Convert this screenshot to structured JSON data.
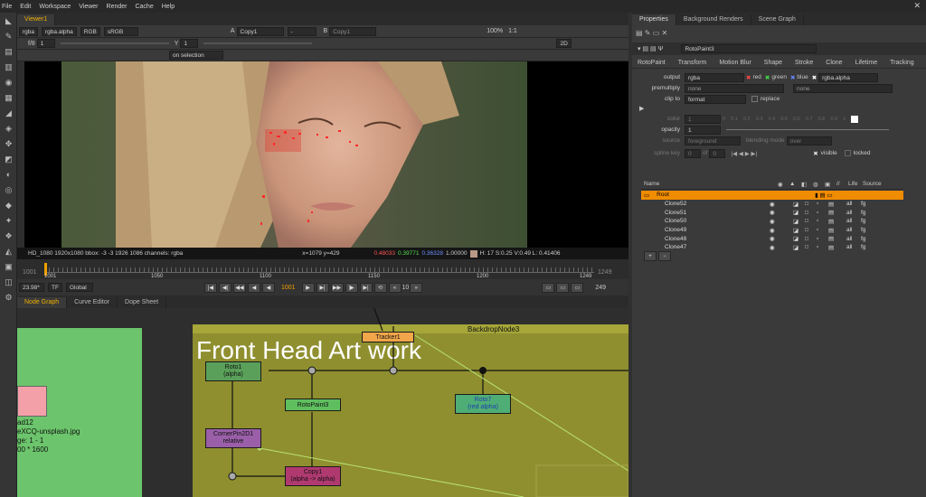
{
  "menu": [
    "File",
    "Edit",
    "Workspace",
    "Viewer",
    "Render",
    "Cache",
    "Help"
  ],
  "viewer_tab": "Viewer1",
  "viewer_controls": {
    "channels": "rgba",
    "layer": "rgba.alpha",
    "colorspace": "RGB",
    "display": "sRGB",
    "input_a_label": "A",
    "input_a": "Copy1",
    "input_a_op": "-",
    "input_b_label": "B",
    "input_b": "Copy1",
    "zoom": "100%",
    "proxy": "1:1",
    "f_stop": "f/8",
    "gain": "1",
    "y_label": "Y",
    "gamma": "1",
    "view_mode": "2D",
    "update_mode": "on selection"
  },
  "info_bar": {
    "format": "HD_1080 1920x1080  bbox: -3 -3 1926 1086 channels: rgba",
    "coords": "x=1079 y=429",
    "r": "0.48033",
    "g": "0.39771",
    "b": "0.36328",
    "a": "1.00000",
    "hsvl": "H: 17 S:0.25 V:0.49  L: 0.41406"
  },
  "timeline": {
    "in": "1001",
    "out": "1249",
    "ticks": [
      "1001",
      "1050",
      "1100",
      "1150",
      "1200",
      "1249"
    ],
    "fps": "23.98*",
    "tf": "TF",
    "range": "Global",
    "current_frame": "1001",
    "increment": "10",
    "end_frame": "249"
  },
  "bottom_tabs": [
    "Node Graph",
    "Curve Editor",
    "Dope Sheet"
  ],
  "node_graph": {
    "backdrop_name": "BackdropNode3",
    "backdrop_label": "Front Head Art work",
    "read_node_lines": [
      "ad12",
      "eXCQ-unsplash.jpg",
      "ge: 1 - 1",
      "00 * 1600"
    ],
    "nodes": {
      "tracker": "Tracker1",
      "roto1": "Roto1",
      "roto1_sub": "(alpha)",
      "rotopaint": "RotoPaint3",
      "roto7": "Roto7",
      "roto7_sub": "(red alpha)",
      "cornerpin": "CornerPin2D1",
      "cornerpin_sub": "relative",
      "copy": "Copy1",
      "copy_sub": "(alpha -> alpha)"
    },
    "colors": {
      "backdrop": "#8f8f30",
      "roto": "#5aa05a",
      "rotopaint": "#5fbf5f",
      "tracker": "#f2a64a",
      "cornerpin": "#9a5fa8",
      "copy": "#b03a70",
      "read_bg": "#6cc56c"
    }
  },
  "properties": {
    "tabs": [
      "Properties",
      "Background Renders",
      "Scene Graph"
    ],
    "node_name": "RotoPaint3",
    "sub_tabs": [
      "RotoPaint",
      "Transform",
      "Motion Blur",
      "Shape",
      "Stroke",
      "Clone",
      "Lifetime",
      "Tracking"
    ],
    "output_label": "output",
    "output": "rgba",
    "red": "red",
    "green": "green",
    "blue": "blue",
    "alpha": "rgba.alpha",
    "premultiply_label": "premultiply",
    "premultiply": "none",
    "premultiply_2": "none",
    "clip_to_label": "clip to",
    "clip_to": "format",
    "replace": "replace",
    "color_label": "color",
    "color_value": "1",
    "color_ticks": [
      "0",
      "0.1",
      "0.2",
      "0.3",
      "0.4",
      "0.5",
      "0.6",
      "0.7",
      "0.8",
      "0.9",
      "1"
    ],
    "opacity_label": "opacity",
    "opacity": "1",
    "source_label": "source",
    "source": "foreground",
    "blending_label": "blending mode",
    "blending": "over",
    "visible": "visible",
    "locked": "locked",
    "spline_key_label": "spline key",
    "spline_key": "0",
    "of": "of",
    "spline_total": "0",
    "columns": [
      "Name",
      "",
      "",
      "",
      "",
      "",
      "",
      "Life",
      "Source"
    ],
    "rows": [
      {
        "name": "Root",
        "life": "",
        "source": "",
        "selected": true
      },
      {
        "name": "Clone52",
        "life": "all",
        "source": "fg",
        "selected": false
      },
      {
        "name": "Clone51",
        "life": "all",
        "source": "fg",
        "selected": false
      },
      {
        "name": "Clone50",
        "life": "all",
        "source": "fg",
        "selected": false
      },
      {
        "name": "Clone49",
        "life": "all",
        "source": "fg",
        "selected": false
      },
      {
        "name": "Clone48",
        "life": "all",
        "source": "fg",
        "selected": false
      },
      {
        "name": "Clone47",
        "life": "all",
        "source": "fg",
        "selected": false
      }
    ]
  },
  "icons": [
    "close-icon",
    "play-icon",
    "stop-icon",
    "lock-icon",
    "eye-icon",
    "settings-icon",
    "plus-icon",
    "minus-icon"
  ]
}
